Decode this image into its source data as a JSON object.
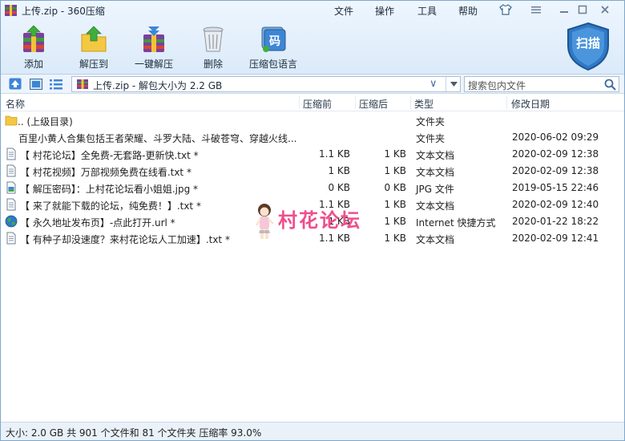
{
  "window": {
    "title": "上传.zip - 360压缩"
  },
  "menu": {
    "file": "文件",
    "operate": "操作",
    "tools": "工具",
    "help": "帮助"
  },
  "toolbar": {
    "add": "添加",
    "extract_to": "解压到",
    "one_click_extract": "一键解压",
    "delete": "删除",
    "encoding": "压缩包语言",
    "encoding_icon_text": "码",
    "scan": "扫描"
  },
  "address": {
    "path": "上传.zip - 解包大小为 2.2 GB",
    "search_placeholder": "搜索包内文件"
  },
  "columns": {
    "name": "名称",
    "compressed": "压缩前",
    "original": "压缩后",
    "type": "类型",
    "modified": "修改日期"
  },
  "files": [
    {
      "icon": "folder-up-icon",
      "name": ".. (上级目录)",
      "compressed": "",
      "original": "",
      "type": "文件夹",
      "modified": ""
    },
    {
      "icon": "folder-icon",
      "name": "百里小黄人合集包括王者荣耀、斗罗大陆、斗破苍穹、穿越火线...",
      "compressed": "",
      "original": "",
      "type": "文件夹",
      "modified": "2020-06-02 09:29"
    },
    {
      "icon": "text-file-icon",
      "name": "【 村花论坛】全免费-无套路-更新快.txt *",
      "compressed": "1.1 KB",
      "original": "1 KB",
      "type": "文本文档",
      "modified": "2020-02-09 12:38"
    },
    {
      "icon": "text-file-icon",
      "name": "【 村花视频】万部视频免费在线看.txt *",
      "compressed": "1 KB",
      "original": "1 KB",
      "type": "文本文档",
      "modified": "2020-02-09 12:38"
    },
    {
      "icon": "image-file-icon",
      "name": "【 解压密码】：上村花论坛看小姐姐.jpg *",
      "compressed": "0 KB",
      "original": "0 KB",
      "type": "JPG 文件",
      "modified": "2019-05-15 22:46"
    },
    {
      "icon": "text-file-icon",
      "name": "【 来了就能下载的论坛，纯免费！】.txt *",
      "compressed": "1.1 KB",
      "original": "1 KB",
      "type": "文本文档",
      "modified": "2020-02-09 12:40"
    },
    {
      "icon": "globe-icon",
      "name": "【 永久地址发布页】-点此打开.url *",
      "compressed": "1 KB",
      "original": "1 KB",
      "type": "Internet 快捷方式",
      "modified": "2020-01-22 18:22"
    },
    {
      "icon": "text-file-icon",
      "name": "【 有种子却没速度？来村花论坛人工加速】.txt *",
      "compressed": "1.1 KB",
      "original": "1 KB",
      "type": "文本文档",
      "modified": "2020-02-09 12:41"
    }
  ],
  "watermark": "村花论坛",
  "status": "大小: 2.0 GB 共 901 个文件和 81 个文件夹 压缩率 93.0%",
  "colors": {
    "accent": "#2e6fb6",
    "watermark": "#f04e8c",
    "folder": "#f5c842"
  }
}
